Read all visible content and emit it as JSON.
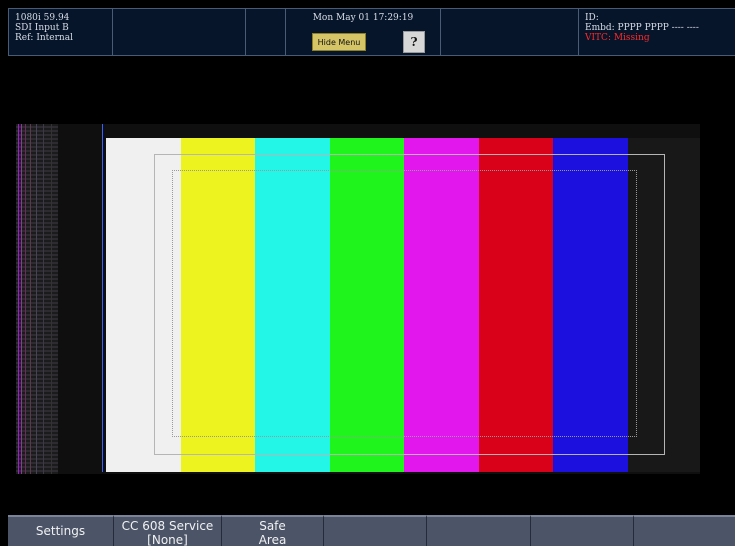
{
  "header": {
    "format": "1080i 59.94",
    "input": "SDI Input B",
    "reference": "Ref: Internal",
    "datetime": "Mon May 01 17:29:19",
    "hide_menu_label": "Hide Menu",
    "help_label": "?",
    "id_label": "ID:",
    "embedded_audio": "Embd: PPPP PPPP ---- ----",
    "vitc_status": "VITC: Missing"
  },
  "picture": {
    "bars_colors": [
      "#f0f0f0",
      "#ecf31f",
      "#23f6e6",
      "#1ff51d",
      "#e117ed",
      "#d9001a",
      "#1b10de"
    ],
    "colors": {
      "safe_action": "#b5b5b5",
      "safe_title": "#9a9a9a",
      "cursor_line": "#3a5fff"
    }
  },
  "menu": {
    "buttons": [
      {
        "line1": "Settings",
        "line2": ""
      },
      {
        "line1": "CC 608 Service",
        "line2": "[None]"
      },
      {
        "line1": "Safe",
        "line2": "Area"
      },
      {
        "line1": "",
        "line2": ""
      },
      {
        "line1": "",
        "line2": ""
      },
      {
        "line1": "",
        "line2": ""
      },
      {
        "line1": "",
        "line2": ""
      }
    ]
  }
}
